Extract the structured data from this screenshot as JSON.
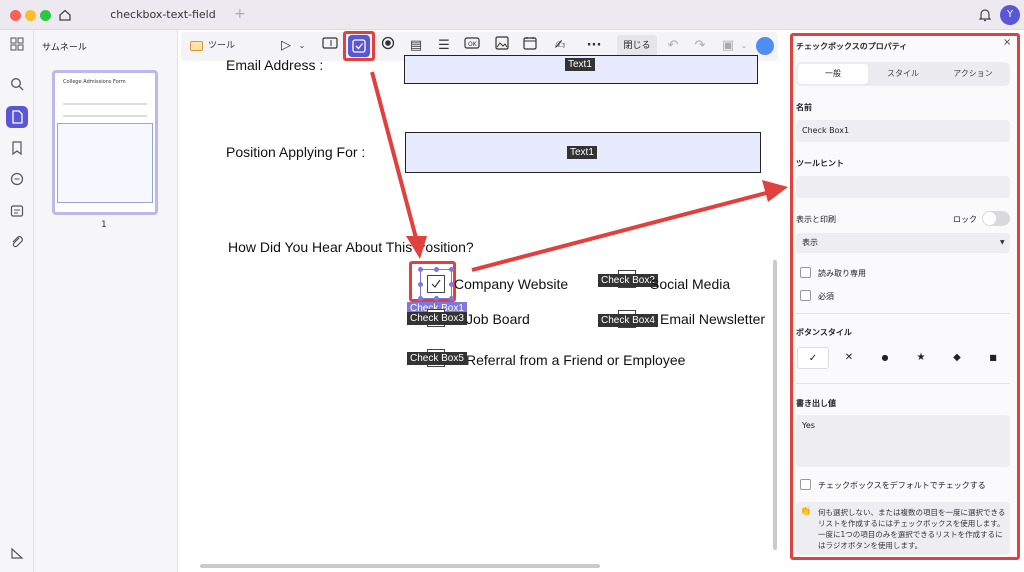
{
  "window": {
    "tab_title": "checkbox-text-field",
    "avatar_initial": "Y"
  },
  "thumbnails": {
    "heading": "サムネール",
    "page_number": "1",
    "page_title": "College Admissions Form"
  },
  "toolbar": {
    "tool_label": "ツール",
    "close_label": "閉じる"
  },
  "document": {
    "email_label": "Email Address :",
    "email_field_tag": "Text1",
    "position_label": "Position Applying For :",
    "position_field_tag": "Text1",
    "question": "How Did You Hear About This Position?",
    "options": [
      {
        "tag": "Check Box1",
        "label": "Company Website"
      },
      {
        "tag": "Check Box2",
        "label": "Social Media"
      },
      {
        "tag": "Check Box3",
        "label": "Job Board"
      },
      {
        "tag": "Check Box4",
        "label": "Email Newsletter"
      },
      {
        "tag": "Check Box5",
        "label": "Referral from a Friend or Employee"
      }
    ]
  },
  "panel": {
    "title": "チェックボックスのプロパティ",
    "tabs": [
      "一般",
      "スタイル",
      "アクション"
    ],
    "name_label": "名前",
    "name_value": "Check Box1",
    "tooltip_label": "ツールヒント",
    "tooltip_value": "",
    "display_print_label": "表示と印刷",
    "lock_label": "ロック",
    "display_value": "表示",
    "readonly_label": "読み取り専用",
    "required_label": "必須",
    "button_style_label": "ボタンスタイル",
    "export_label": "書き出し値",
    "export_value": "Yes",
    "default_check_label": "チェックボックスをデフォルトでチェックする",
    "hint_text": "何も選択しない、または複数の項目を一度に選択できるリストを作成するにはチェックボックスを使用します。一度に1つの項目のみを選択できるリストを作成するにはラジオボタンを使用します。"
  },
  "colors": {
    "accent": "#5b56d6",
    "highlight_red": "#e0403e",
    "field_fill": "#e8eaff"
  }
}
